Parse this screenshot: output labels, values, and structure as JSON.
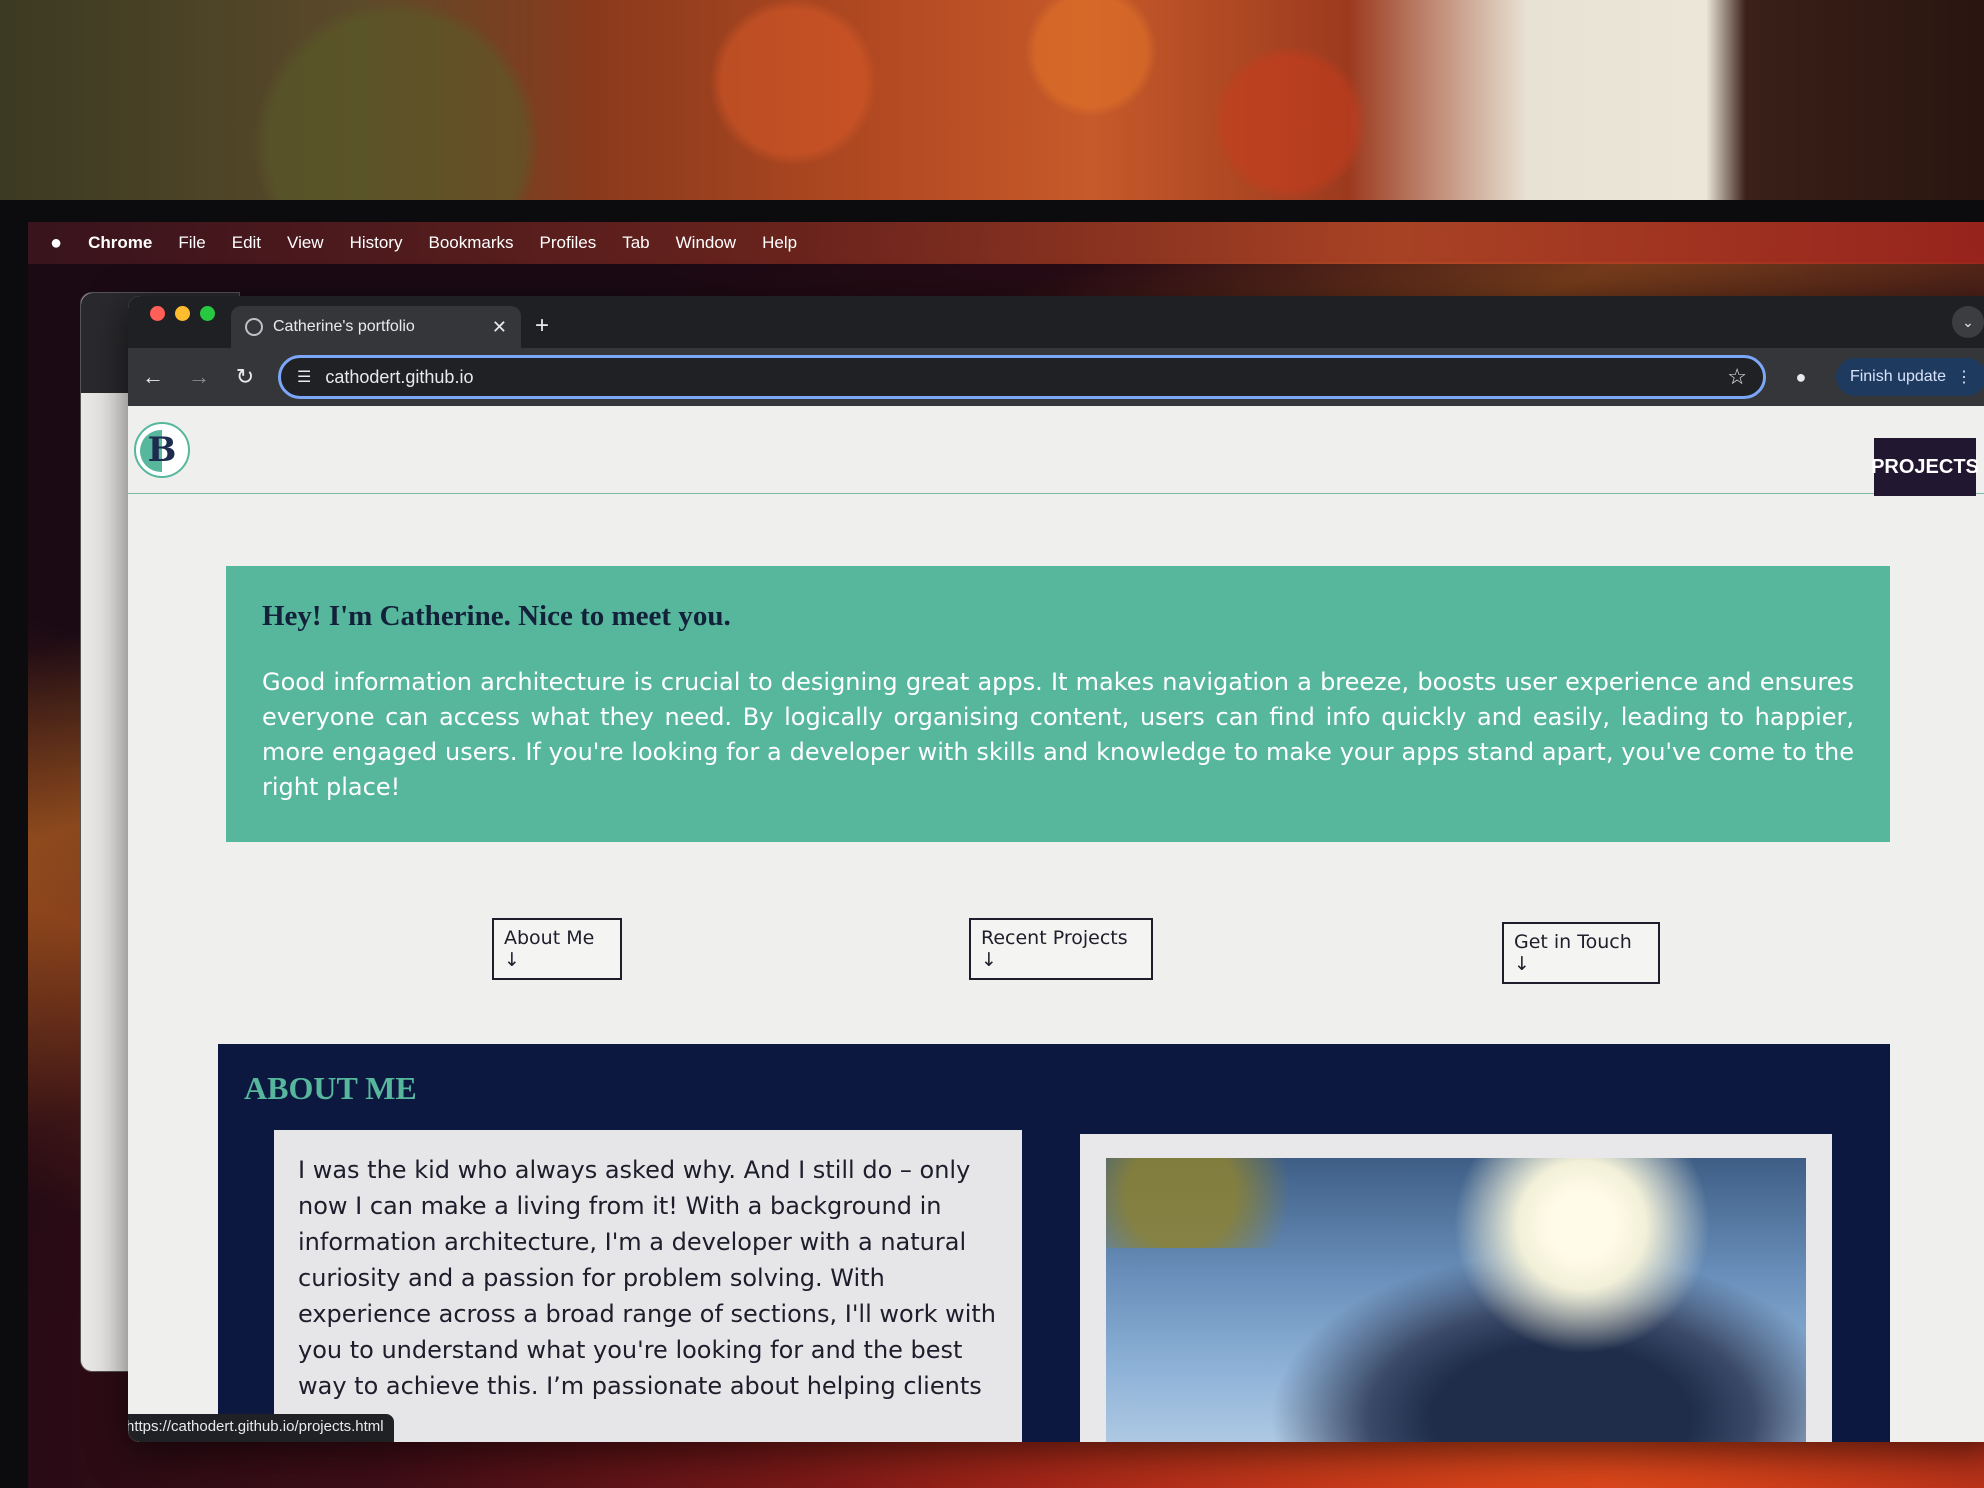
{
  "menubar": {
    "apple": "",
    "items": [
      "Chrome",
      "File",
      "Edit",
      "View",
      "History",
      "Bookmarks",
      "Profiles",
      "Tab",
      "Window",
      "Help"
    ]
  },
  "browser": {
    "tab_title": "Catherine's portfolio",
    "tab_close": "✕",
    "new_tab": "+",
    "tab_menu": "⌄",
    "address": "cathodert.github.io",
    "finish_update": "Finish update",
    "status_url": "https://cathodert.github.io/projects.html"
  },
  "site": {
    "logo_letter": "B",
    "projects_label": "PROJECTS",
    "hero_title": "Hey! I'm Catherine. Nice to meet you.",
    "hero_text": "Good information architecture is crucial to designing great apps. It makes navigation a breeze, boosts user experience and ensures everyone can access what they need. By logically organising content, users can find info quickly and easily, leading to happier, more engaged users. If you're looking for a developer with skills and knowledge to make your apps stand apart, you've come to the right place!",
    "nav": [
      "About Me ↓",
      "Recent Projects ↓",
      "Get in Touch ↓"
    ],
    "about_heading": "ABOUT ME",
    "about_text": "I was the kid who always asked why. And I still do – only now I can make a living from it! With a background in information architecture, I'm a developer with a natural curiosity and a passion for problem solving. With experience across a broad range of sections, I'll work with you to understand what you're looking for and the best way to achieve this. I’m passionate about helping clients"
  },
  "colors": {
    "accent": "#56b79d",
    "navy": "#0c1840",
    "projects_bg": "#221731"
  }
}
